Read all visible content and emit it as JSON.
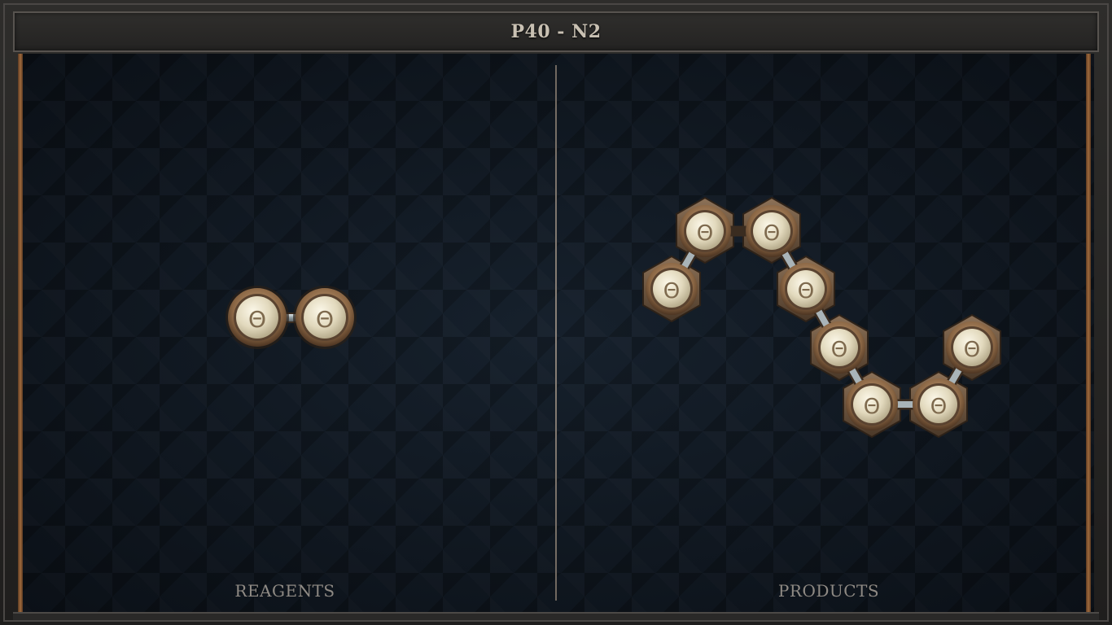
{
  "title": "P40 - N2",
  "panels": {
    "reagents_label": "REAGENTS",
    "products_label": "PRODUCTS"
  },
  "atom_symbol": "Θ",
  "colors": {
    "board": "#121a24",
    "rail": "#a06a3c",
    "atom_face": "#ede6cf",
    "atom_rim": "#9c7a58",
    "bond": "#a9b4b8"
  },
  "molecules": {
    "reagent": {
      "atom_count": 2,
      "bond_count": 1
    },
    "product": {
      "atom_count": 8,
      "bond_count": 7
    }
  }
}
